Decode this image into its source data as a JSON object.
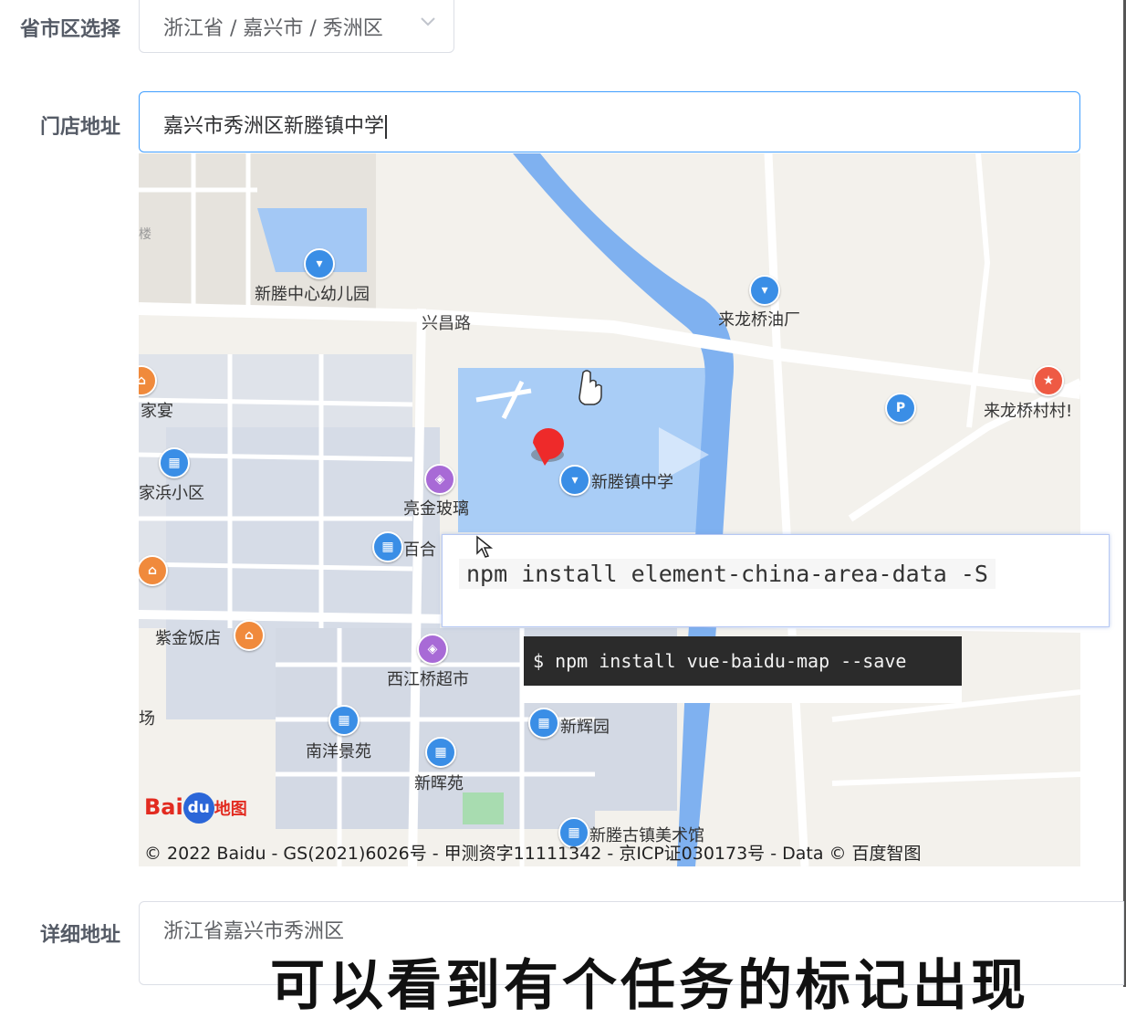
{
  "form": {
    "region_label": "省市区选择",
    "region_value": "浙江省 / 嘉兴市 / 秀洲区",
    "address_label": "门店地址",
    "address_value": "嘉兴市秀洲区新塍镇中学",
    "detail_label": "详细地址",
    "detail_value": "浙江省嘉兴市秀洲区"
  },
  "map": {
    "roads": [
      "兴昌路"
    ],
    "pois": [
      {
        "label": "新塍中心幼儿园",
        "icon": "park-icon"
      },
      {
        "label": "来龙桥油厂",
        "icon": "pin-icon"
      },
      {
        "label": "来龙桥村村!",
        "icon": "red-pin-icon"
      },
      {
        "label": "家宴",
        "icon": "restaurant-icon"
      },
      {
        "label": "家浜小区",
        "icon": "residence-icon"
      },
      {
        "label": "亮金玻璃",
        "icon": "shop-icon"
      },
      {
        "label": "新塍镇中学",
        "icon": "school-icon"
      },
      {
        "label": "百合",
        "icon": "residence-icon"
      },
      {
        "label": "紫金饭店",
        "icon": "restaurant-icon"
      },
      {
        "label": "西江桥超市",
        "icon": "shop-icon"
      },
      {
        "label": "场",
        "icon": ""
      },
      {
        "label": "南洋景苑",
        "icon": "residence-icon"
      },
      {
        "label": "新辉园",
        "icon": "residence-icon"
      },
      {
        "label": "新晖苑",
        "icon": "residence-icon"
      },
      {
        "label": "新塍古镇美术馆",
        "icon": "museum-icon"
      },
      {
        "label": "楼",
        "icon": ""
      }
    ],
    "parking_label": "P",
    "logo": {
      "bai": "Bai",
      "du": "du",
      "ditu": "地图"
    },
    "copyright": "© 2022 Baidu - GS(2021)6026号 - 甲测资字11111342 - 京ICP证030173号 - Data © 百度智图"
  },
  "overlays": {
    "npm_china_area": "npm install element-china-area-data -S",
    "npm_baidu_map": "$ npm install vue-baidu-map --save"
  },
  "subtitle": "可以看到有个任务的标记出现",
  "colors": {
    "focus_border": "#409eff",
    "water": "#a3c8f5",
    "river": "#7fb1f0",
    "terminal_bg": "#2b2b2b"
  }
}
